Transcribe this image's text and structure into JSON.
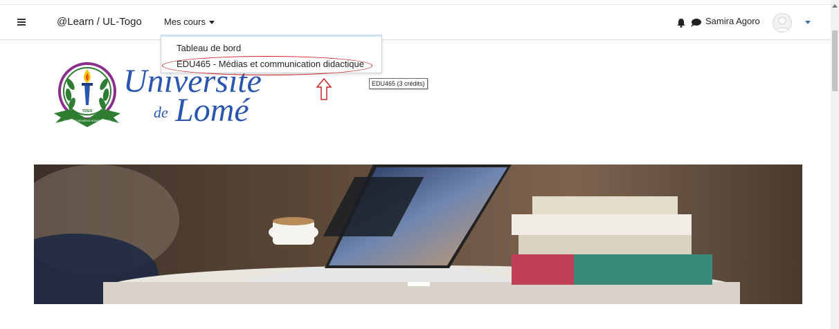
{
  "navbar": {
    "brand": "@Learn / UL-Togo",
    "my_courses": "Mes cours",
    "user_name": "Samira Agoro"
  },
  "dropdown": {
    "items": [
      {
        "label": "Tableau de bord"
      },
      {
        "label": "EDU465 - Médias et communication didactique"
      }
    ]
  },
  "tooltip": "EDU465 (3 crédits)",
  "logo": {
    "line1": "Universite",
    "line2_small": "de",
    "line2": "Lomé",
    "emblem_ribbon": "FUTURAE GENERIS HUMANI FIDES",
    "emblem_country": "TOGO"
  },
  "icons": {
    "menu": "hamburger-icon",
    "notifications": "bell-icon",
    "messages": "chat-bubble-icon",
    "user": "avatar-icon",
    "annotation": "up-arrow-icon"
  },
  "colors": {
    "brand_text": "#2b56b0",
    "annotation": "#cc2222",
    "accent": "#3a6fa8"
  }
}
